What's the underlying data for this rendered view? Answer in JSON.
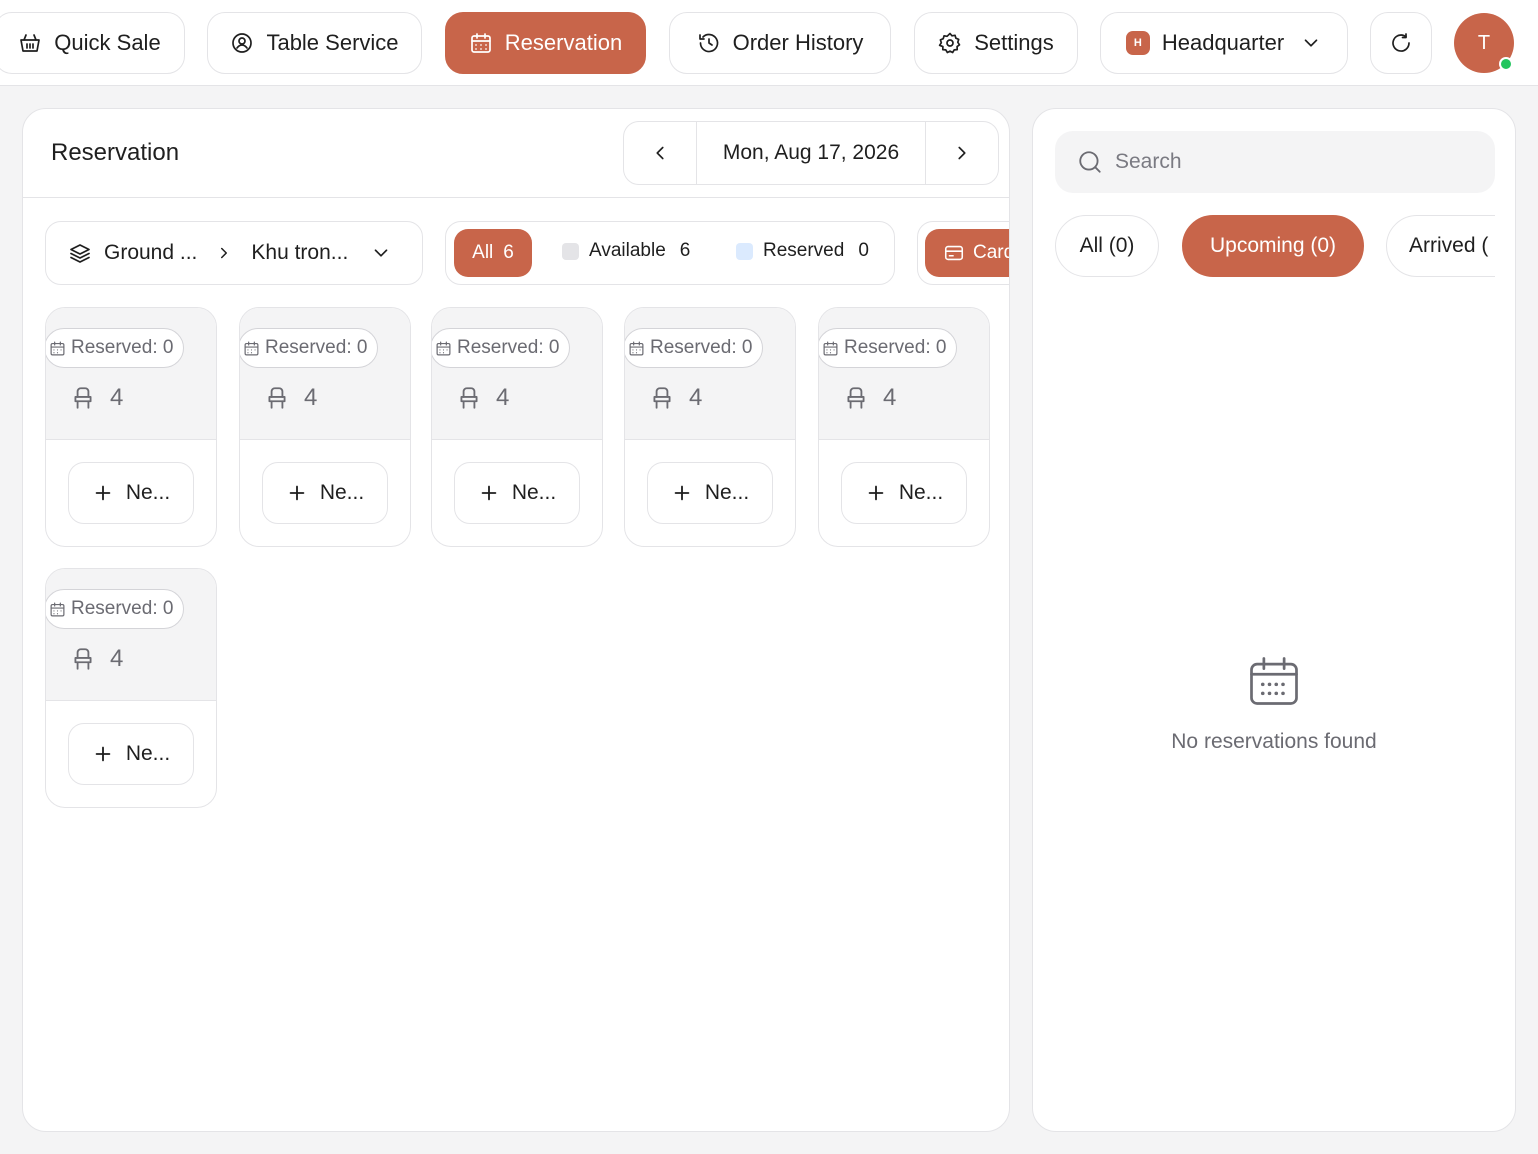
{
  "nav": {
    "quick_sale": "Quick Sale",
    "table_service": "Table Service",
    "reservation": "Reservation",
    "order_history": "Order History",
    "settings": "Settings",
    "branch_badge": "H",
    "branch": "Headquarter",
    "avatar_initial": "T"
  },
  "main": {
    "title": "Reservation",
    "date": "Mon, Aug 17, 2026",
    "floor": "Ground ...",
    "area": "Khu tron...",
    "filters": {
      "all_label": "All",
      "all_count": "6",
      "available_label": "Available",
      "available_count": "6",
      "reserved_label": "Reserved",
      "reserved_count": "0"
    },
    "view_label": "Card",
    "tables": [
      {
        "reserved": "Reserved: 0",
        "seats": "4",
        "new_label": "Ne..."
      },
      {
        "reserved": "Reserved: 0",
        "seats": "4",
        "new_label": "Ne..."
      },
      {
        "reserved": "Reserved: 0",
        "seats": "4",
        "new_label": "Ne..."
      },
      {
        "reserved": "Reserved: 0",
        "seats": "4",
        "new_label": "Ne..."
      },
      {
        "reserved": "Reserved: 0",
        "seats": "4",
        "new_label": "Ne..."
      },
      {
        "reserved": "Reserved: 0",
        "seats": "4",
        "new_label": "Ne..."
      }
    ]
  },
  "side": {
    "search_placeholder": "Search",
    "tabs": [
      "All (0)",
      "Upcoming (0)",
      "Arrived ("
    ],
    "empty_text": "No reservations found"
  },
  "colors": {
    "accent": "#c8654a",
    "available": "#e4e4e7",
    "reserved": "#dbeafe",
    "online": "#22c55e"
  }
}
